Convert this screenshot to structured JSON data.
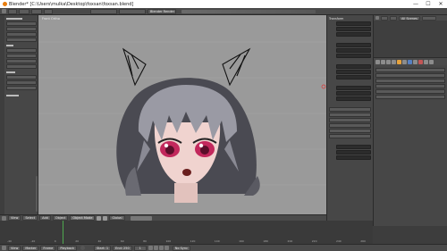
{
  "window": {
    "title": "Blender* [C:\\Users\\mulka\\Desktop\\foxsan\\foxsan.blend]",
    "minimize": "—",
    "maximize": "☐",
    "close": "✕"
  },
  "info_header": {
    "render_engine": "Blender Render"
  },
  "toolshelf": {
    "buttons": [
      "",
      "",
      "",
      "",
      "",
      "",
      "",
      "",
      "",
      "",
      ""
    ]
  },
  "viewport": {
    "label": "Front Ortho",
    "background": "#9a9a9a"
  },
  "properties_panel": {
    "heading": "Transform",
    "rows": [
      {
        "label": "",
        "value": ""
      },
      {
        "label": "",
        "value": ""
      },
      {
        "label": "",
        "value": ""
      }
    ]
  },
  "outliner": {
    "header_label": "All Scenes",
    "items": [
      "",
      "",
      "",
      "",
      "",
      ""
    ]
  },
  "editor": {
    "rows": [
      "",
      "",
      "",
      "",
      "",
      ""
    ]
  },
  "viewport_header": {
    "view": "View",
    "select": "Select",
    "add": "Add",
    "object": "Object",
    "mode": "Object Mode",
    "pivot": "Global"
  },
  "timeline_header": {
    "view": "View",
    "marker": "Marker",
    "frame": "Frame",
    "playback": "Playback",
    "start_label": "Start:",
    "start_value": "1",
    "end_label": "End:",
    "end_value": "250",
    "current_frame": "1",
    "sync": "No Sync"
  },
  "timeline": {
    "ticks": [
      "-40",
      "-20",
      "0",
      "20",
      "40",
      "60",
      "80",
      "100",
      "120",
      "140",
      "160",
      "180",
      "200",
      "220",
      "240",
      "260"
    ]
  },
  "colors": {
    "accent": "#e6a23c",
    "selection": "#5680c2",
    "panel": "#474747"
  }
}
